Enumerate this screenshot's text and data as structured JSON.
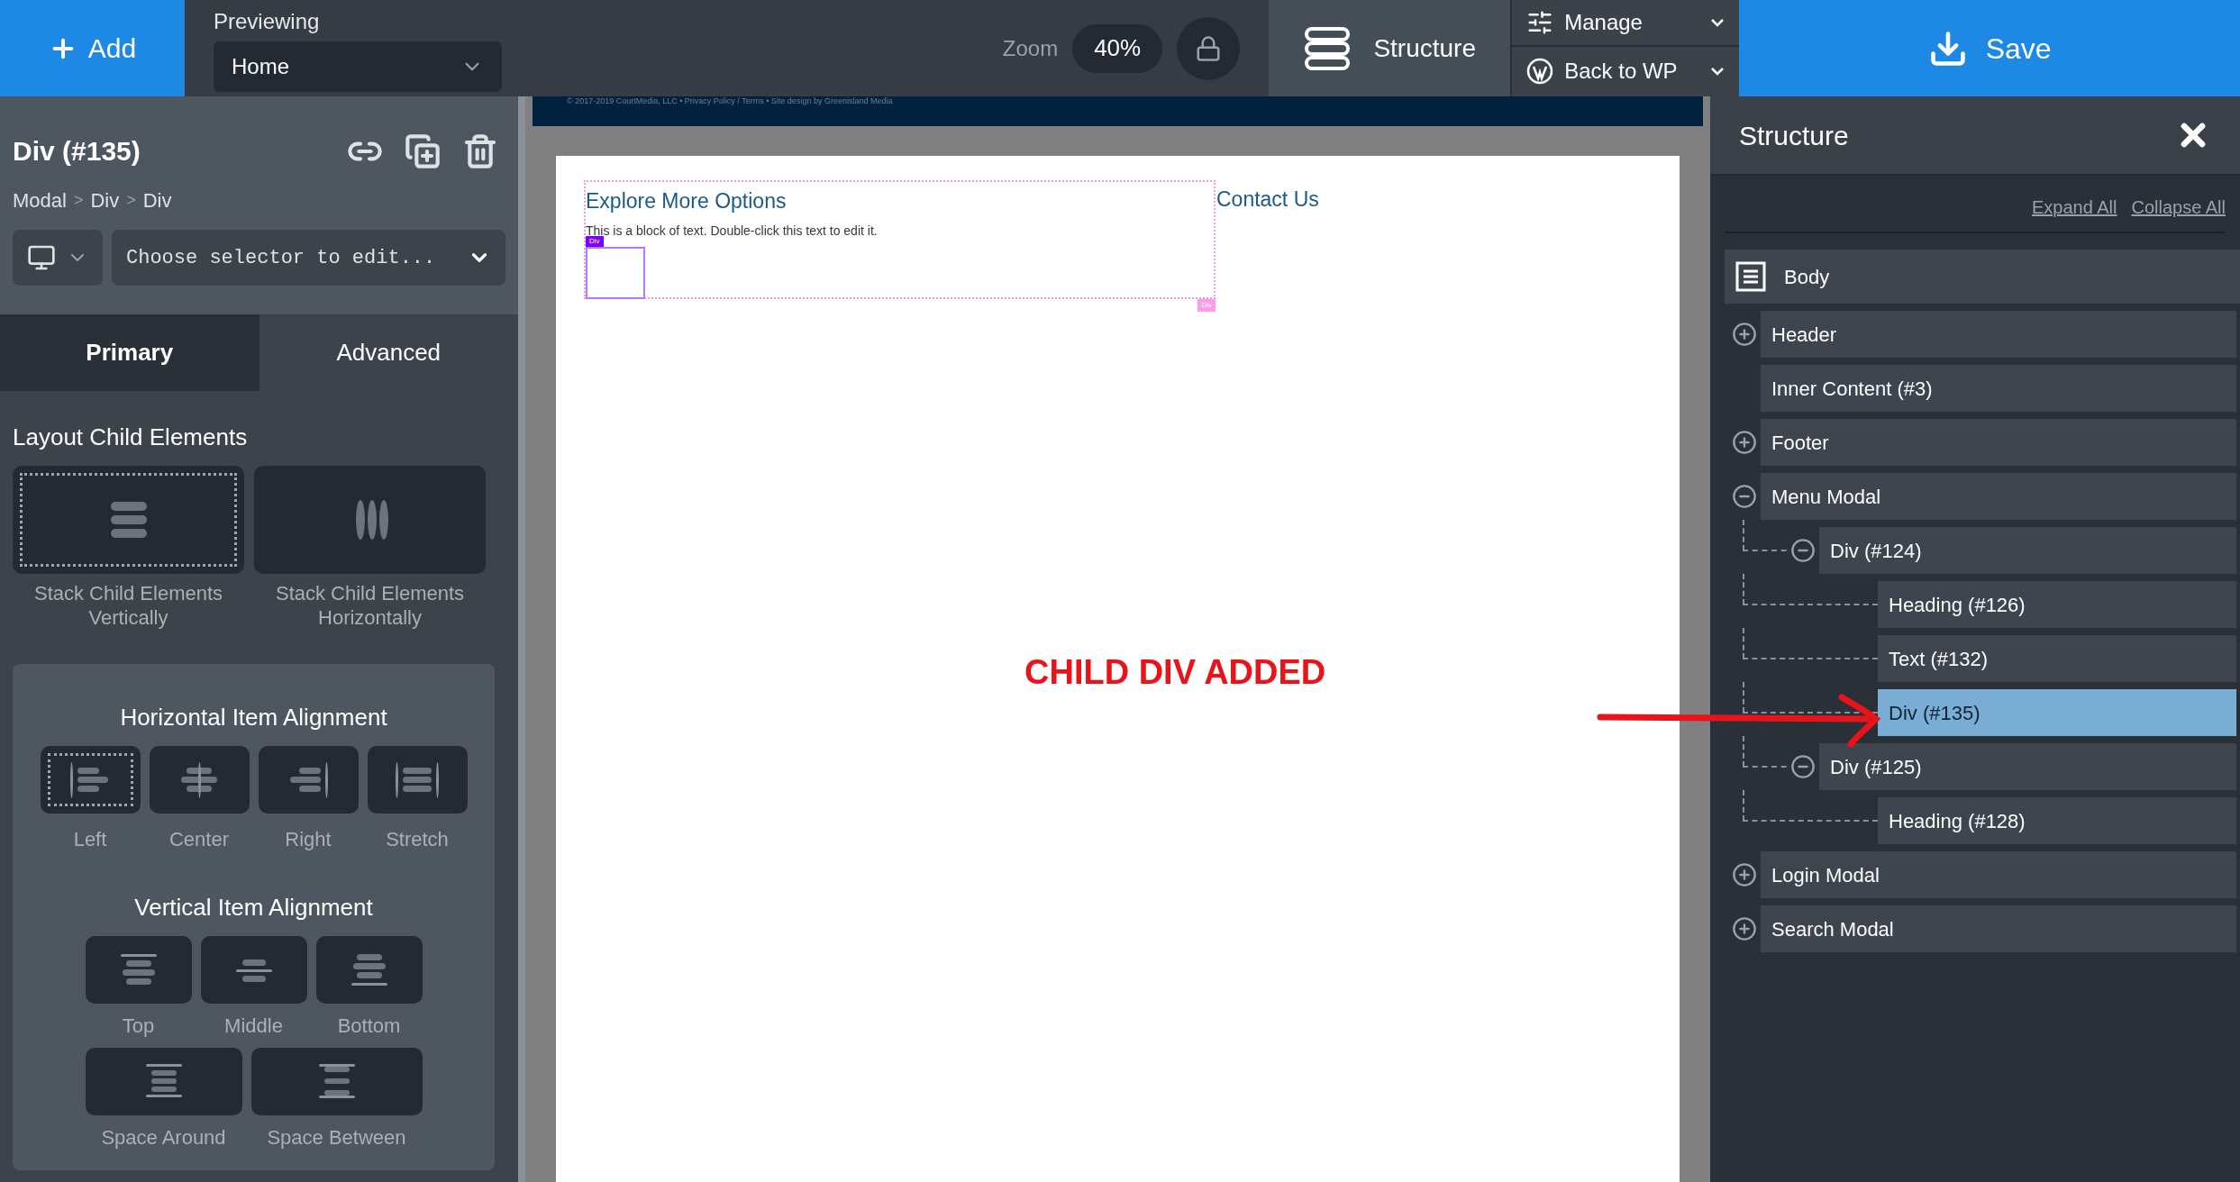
{
  "topbar": {
    "add_button": "Add",
    "previewing_label": "Previewing",
    "page_select": "Home",
    "zoom_label": "Zoom",
    "zoom_value": "40%",
    "structure_button": {
      "label": "Structure",
      "selected": true
    },
    "manage_button": "Manage",
    "back_button": "Back to WP",
    "save_button": "Save"
  },
  "element_panel": {
    "title": "Div (#135)",
    "breadcrumb": [
      {
        "label": "Modal"
      },
      {
        "separator": ">",
        "label": "Div"
      },
      {
        "separator": ">",
        "label": "Div"
      }
    ],
    "selector_placeholder": "Choose selector to edit...",
    "tabs": [
      {
        "label": "Primary",
        "selected": true
      },
      {
        "label": "Advanced",
        "selected": false
      }
    ],
    "layout_heading": "Layout Child Elements",
    "layout_options": [
      {
        "kind": "vertical",
        "label": "Stack Child Elements Vertically",
        "selected": true
      },
      {
        "kind": "horizontal",
        "label": "Stack Child Elements Horizontally",
        "selected": false
      }
    ],
    "horizontal_heading": "Horizontal Item Alignment",
    "horizontal_options": [
      {
        "kind": "left",
        "label": "Left",
        "selected": true
      },
      {
        "kind": "center",
        "label": "Center",
        "selected": false
      },
      {
        "kind": "right",
        "label": "Right",
        "selected": false
      },
      {
        "kind": "stretch",
        "label": "Stretch",
        "selected": false
      }
    ],
    "vertical_heading": "Vertical Item Alignment",
    "vertical_options": [
      {
        "kind": "top",
        "label": "Top",
        "selected": false
      },
      {
        "kind": "middle",
        "label": "Middle",
        "selected": false
      },
      {
        "kind": "bottom",
        "label": "Bottom",
        "selected": false
      },
      {
        "kind": "around",
        "label": "Space Around",
        "selected": false
      },
      {
        "kind": "between",
        "label": "Space Between",
        "selected": false
      }
    ]
  },
  "canvas": {
    "footer_text": "© 2017-2019 CourtMedia, LLC • Privacy Policy / Terms • Site design by Greenisland Media",
    "heading": "Explore More Options",
    "paragraph": "This is a block of text. Double-click this text to edit it.",
    "side_heading": "Contact Us",
    "selected_badge": "Div",
    "parent_badge": "Div",
    "annotation": "CHILD DIV ADDED"
  },
  "structure": {
    "title": "Structure",
    "expand_all": "Expand All",
    "collapse_all": "Collapse All",
    "root": {
      "label": "Body",
      "children": [
        {
          "label": "Header",
          "expanded": false,
          "selected": false
        },
        {
          "label": "Inner Content (#3)",
          "selected": false
        },
        {
          "label": "Footer",
          "expanded": false,
          "selected": false
        },
        {
          "label": "Menu Modal",
          "expanded": true,
          "selected": false,
          "children": [
            {
              "label": "Div (#124)",
              "expanded": true,
              "selected": false,
              "children": [
                {
                  "label": "Heading (#126)",
                  "selected": false
                },
                {
                  "label": "Text (#132)",
                  "selected": false
                },
                {
                  "label": "Div (#135)",
                  "selected": true
                }
              ]
            },
            {
              "label": "Div (#125)",
              "expanded": true,
              "selected": false,
              "children": [
                {
                  "label": "Heading (#128)",
                  "selected": false
                }
              ]
            }
          ]
        },
        {
          "label": "Login Modal",
          "expanded": false,
          "selected": false
        },
        {
          "label": "Search Modal",
          "expanded": false,
          "selected": false
        }
      ]
    }
  }
}
